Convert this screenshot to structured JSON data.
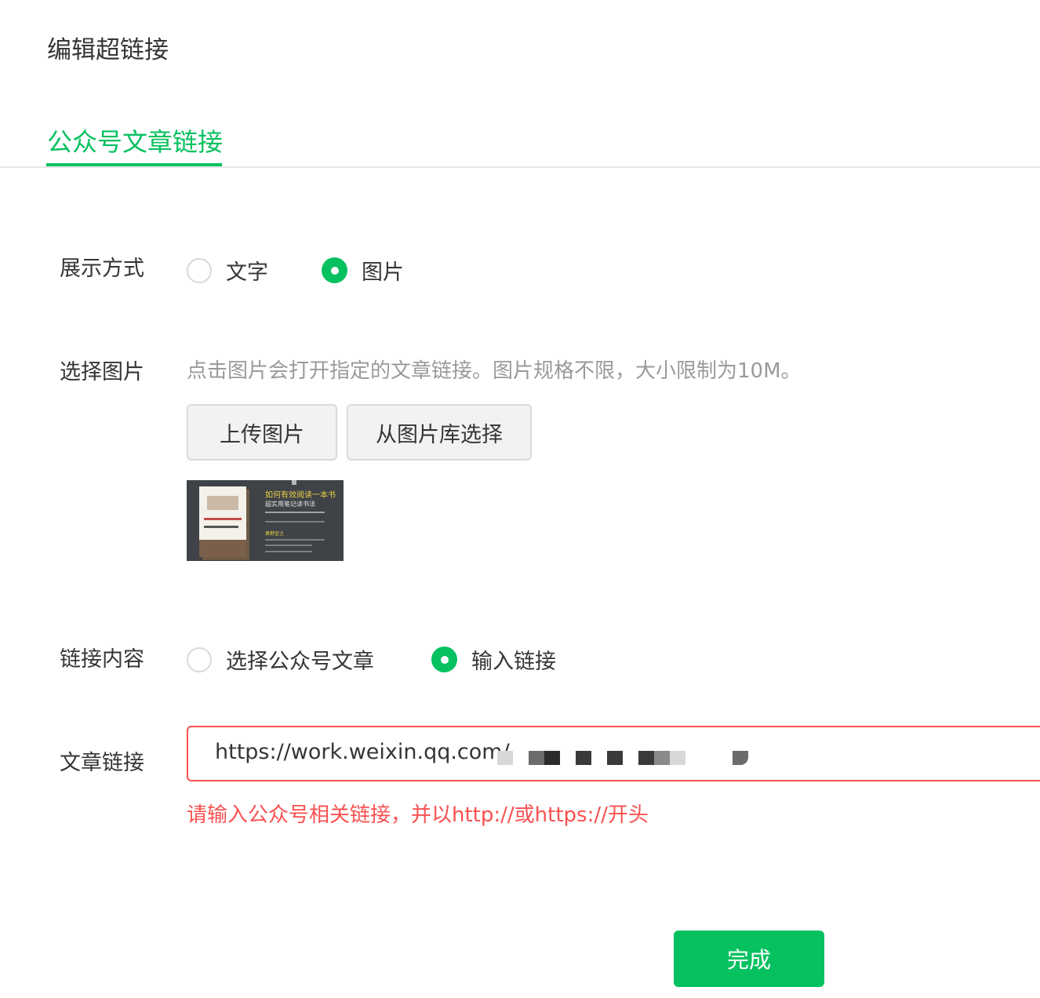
{
  "dialog": {
    "title": "编辑超链接"
  },
  "tabs": [
    {
      "label": "公众号文章链接",
      "active": true
    }
  ],
  "display_mode": {
    "label": "展示方式",
    "options": [
      {
        "label": "文字",
        "checked": false
      },
      {
        "label": "图片",
        "checked": true
      }
    ]
  },
  "select_image": {
    "label": "选择图片",
    "hint": "点击图片会打开指定的文章链接。图片规格不限，大小限制为10M。",
    "upload_button": "上传图片",
    "library_button": "从图片库选择",
    "thumbnail": {
      "title": "如何有效阅读一本书",
      "subtitle": "超实用笔记读书法",
      "tag": "奥野宣之",
      "icon": "book-cover-image"
    }
  },
  "link_content": {
    "label": "链接内容",
    "options": [
      {
        "label": "选择公众号文章",
        "checked": false
      },
      {
        "label": "输入链接",
        "checked": true
      }
    ]
  },
  "article_link": {
    "label": "文章链接",
    "value": "https://work.weixin.qq.com/",
    "error": "请输入公众号相关链接，并以http://或https://开头"
  },
  "footer": {
    "done_label": "完成"
  },
  "colors": {
    "accent": "#07c160",
    "error": "#fa5151",
    "text": "#353535",
    "hint": "#9a9a9a"
  }
}
